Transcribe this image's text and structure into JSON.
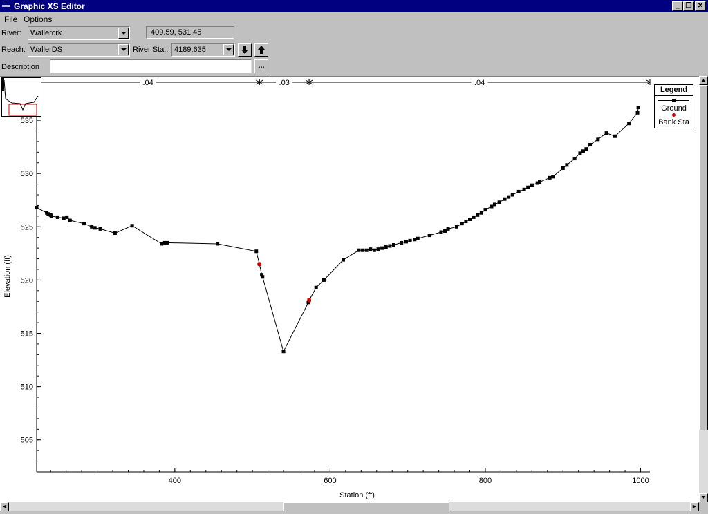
{
  "window": {
    "title": "Graphic XS Editor"
  },
  "menu": {
    "file": "File",
    "options": "Options"
  },
  "form": {
    "river_label": "River:",
    "river_value": "Wallercrk",
    "reach_label": "Reach:",
    "reach_value": "WallerDS",
    "river_sta_label": "River Sta.:",
    "river_sta_value": "4189.635",
    "description_label": "Description",
    "description_value": "",
    "browse_label": "...",
    "cursor_readout": "409.59, 531.45"
  },
  "legend": {
    "title": "Legend",
    "ground": "Ground",
    "bank_sta": "Bank Sta"
  },
  "colors": {
    "ground": "#000000",
    "bank": "#d00000",
    "titlebar": "#000080"
  },
  "chart_data": {
    "type": "line",
    "xlabel": "Station (ft)",
    "ylabel": "Elevation (ft)",
    "xlim": [
      222,
      1012
    ],
    "ylim": [
      502.0,
      538.7
    ],
    "xticks": [
      400,
      600,
      800,
      1000
    ],
    "yticks": [
      505,
      510,
      515,
      520,
      525,
      530,
      535
    ],
    "manning": [
      {
        "label": ".04",
        "from": 222,
        "to": 509
      },
      {
        "label": ".03",
        "from": 509,
        "to": 573
      },
      {
        "label": ".04",
        "from": 573,
        "to": 1012
      }
    ],
    "series": [
      {
        "name": "Ground",
        "x": [
          222,
          235,
          237,
          240,
          241,
          249,
          257,
          261,
          265,
          283,
          293,
          297,
          304,
          323,
          345,
          383,
          387,
          390,
          455,
          505,
          509,
          512,
          513,
          540,
          572,
          573,
          582,
          592,
          617,
          637,
          642,
          647,
          652,
          657,
          662,
          667,
          672,
          677,
          682,
          692,
          698,
          703,
          709,
          713,
          728,
          743,
          748,
          752,
          763,
          770,
          775,
          780,
          785,
          790,
          795,
          800,
          808,
          812,
          818,
          825,
          830,
          835,
          843,
          850,
          855,
          860,
          867,
          870,
          883,
          887,
          900,
          905,
          915,
          922,
          926,
          930,
          935,
          945,
          956,
          967,
          985,
          996,
          997
        ],
        "y": [
          526.8,
          526.3,
          526.2,
          526.1,
          526.0,
          525.9,
          525.8,
          525.9,
          525.6,
          525.3,
          525.0,
          524.9,
          524.8,
          524.4,
          525.1,
          523.4,
          523.5,
          523.5,
          523.4,
          522.7,
          521.5,
          520.5,
          520.3,
          513.3,
          517.9,
          518.1,
          519.3,
          520.0,
          521.9,
          522.8,
          522.8,
          522.8,
          522.9,
          522.8,
          522.9,
          523.0,
          523.1,
          523.2,
          523.3,
          523.5,
          523.6,
          523.7,
          523.8,
          523.9,
          524.2,
          524.5,
          524.6,
          524.8,
          525.0,
          525.3,
          525.5,
          525.7,
          525.9,
          526.1,
          526.3,
          526.6,
          526.9,
          527.1,
          527.3,
          527.6,
          527.8,
          528.0,
          528.3,
          528.5,
          528.7,
          528.9,
          529.1,
          529.2,
          529.6,
          529.7,
          530.5,
          530.8,
          531.4,
          531.9,
          532.1,
          532.3,
          532.7,
          533.2,
          533.8,
          533.5,
          534.7,
          535.7,
          536.2
        ]
      },
      {
        "name": "Bank Sta",
        "x": [
          509,
          573
        ],
        "y": [
          521.5,
          518.1
        ]
      }
    ]
  }
}
